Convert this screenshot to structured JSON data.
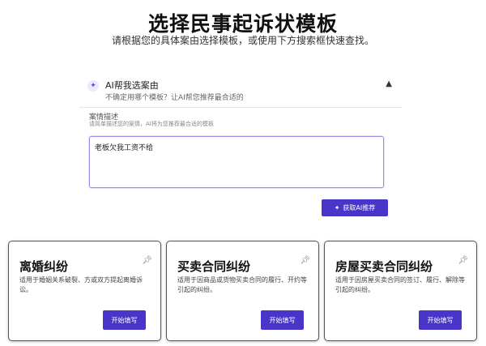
{
  "header": {
    "title": "选择民事起诉状模板",
    "subtitle": "请根据您的具体案由选择模板，或使用下方搜索框快速查找。"
  },
  "ai_panel": {
    "icon": "sparkle-icon",
    "title": "AI帮我选案由",
    "hint": "不确定用哪个模板？让AI帮您推荐最合适的",
    "collapse_icon": "chevron-up-icon",
    "field_label": "案情描述",
    "field_help": "请简单描述您的案情，AI将为您推荐最合适的模板",
    "textarea_value": "老板欠我工资不给",
    "button_label": "获取AI推荐",
    "button_icon": "sparkle-icon",
    "accent_color": "#4a35c9"
  },
  "cards": [
    {
      "title": "离婚纠纷",
      "description": "适用于婚姻关系破裂、方或双方提起离婚诉讼。",
      "button_label": "开始填写",
      "icon": "pin-icon"
    },
    {
      "title": "买卖合同纠纷",
      "description": "适用于因商品或货物买卖合同的履行、开约等引起的纠纷。",
      "button_label": "开始填写",
      "icon": "pin-icon"
    },
    {
      "title": "房屋买卖合同纠纷",
      "description": "适用于因房屋买卖合同的签订、履行、解除等引起的纠纷。",
      "button_label": "开始填写",
      "icon": "pin-icon"
    }
  ]
}
